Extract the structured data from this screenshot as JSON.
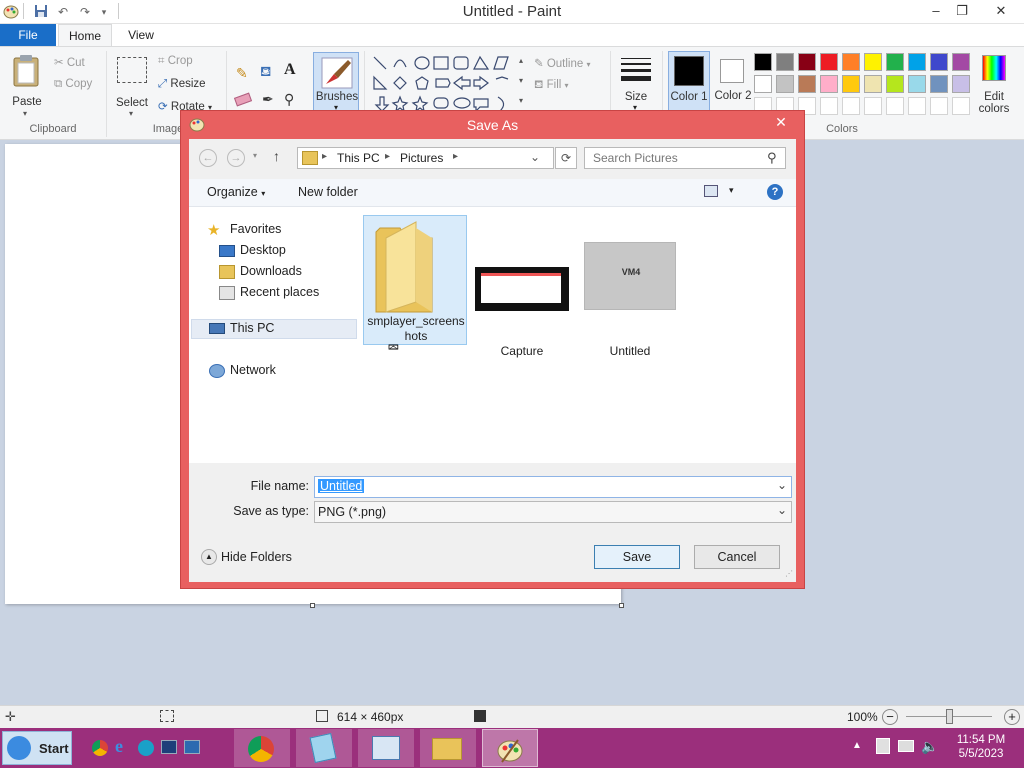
{
  "window": {
    "title": "Untitled - Paint"
  },
  "tabs": {
    "file": "File",
    "home": "Home",
    "view": "View"
  },
  "ribbon": {
    "clipboard": {
      "paste": "Paste",
      "cut": "Cut",
      "copy": "Copy",
      "label": "Clipboard"
    },
    "image": {
      "select": "Select",
      "crop": "Crop",
      "resize": "Resize",
      "rotate": "Rotate",
      "label": "Image"
    },
    "brushes": "Brushes",
    "shapes": {
      "outline": "Outline",
      "fill": "Fill"
    },
    "size": "Size",
    "color1": "Color 1",
    "color2": "Color 2",
    "colors_label": "Colors",
    "edit_colors": "Edit colors",
    "palette_row1": [
      "#000000",
      "#7f7f7f",
      "#880015",
      "#ed1c24",
      "#ff7f27",
      "#fff200",
      "#22b14c",
      "#00a2e8",
      "#3f48cc",
      "#a349a4"
    ],
    "palette_row2": [
      "#ffffff",
      "#c3c3c3",
      "#b97a57",
      "#ffaec9",
      "#ffc90e",
      "#efe4b0",
      "#b5e61d",
      "#99d9ea",
      "#7092be",
      "#c8bfe7"
    ]
  },
  "dialog": {
    "title": "Save As",
    "address": {
      "root": "This PC",
      "folder": "Pictures"
    },
    "search_placeholder": "Search Pictures",
    "organize": "Organize",
    "new_folder": "New folder",
    "nav": {
      "favorites": "Favorites",
      "desktop": "Desktop",
      "downloads": "Downloads",
      "recent": "Recent places",
      "this_pc": "This PC",
      "network": "Network"
    },
    "files": [
      {
        "name": "sm_layer_screenshots",
        "line1": "smplayer_screens",
        "line2": "hots"
      },
      {
        "name": "Capture",
        "line1": "Capture"
      },
      {
        "name": "Untitled",
        "line1": "Untitled",
        "thumb_text": "VM4"
      }
    ],
    "file_name_label": "File name:",
    "file_name_value": "Untitled",
    "save_type_label": "Save as type:",
    "save_type_value": "PNG (*.png)",
    "hide_folders": "Hide Folders",
    "save": "Save",
    "cancel": "Cancel"
  },
  "status": {
    "dimensions": "614 × 460px",
    "zoom": "100%",
    "zoom_fraction": 0.5
  },
  "taskbar": {
    "start": "Start",
    "time": "11:54 PM",
    "date": "5/5/2023"
  }
}
